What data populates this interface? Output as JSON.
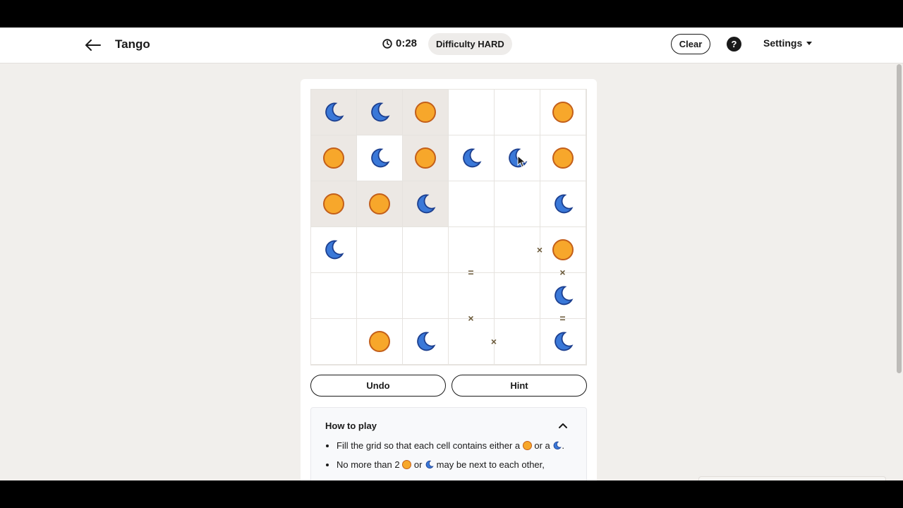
{
  "header": {
    "back_icon": "arrow-left-icon",
    "title": "Tango",
    "timer": "0:28",
    "timer_icon": "clock-icon",
    "difficulty": "Difficulty HARD",
    "clear_label": "Clear",
    "help_label": "?",
    "settings_label": "Settings"
  },
  "grid": {
    "rows": [
      [
        "moon",
        "moon",
        "sun",
        "",
        "",
        "sun"
      ],
      [
        "sun",
        "moon",
        "sun",
        "moon",
        "moon",
        "sun"
      ],
      [
        "sun",
        "sun",
        "moon",
        "",
        "",
        "moon"
      ],
      [
        "moon",
        "",
        "",
        "",
        "",
        "sun"
      ],
      [
        "",
        "",
        "",
        "",
        "",
        "moon"
      ],
      [
        "",
        "sun",
        "moon",
        "",
        "",
        "moon"
      ]
    ],
    "locked": [
      [
        true,
        true,
        true,
        false,
        false,
        false
      ],
      [
        true,
        false,
        true,
        false,
        false,
        false
      ],
      [
        true,
        true,
        true,
        false,
        false,
        false
      ],
      [
        false,
        false,
        false,
        false,
        false,
        false
      ],
      [
        false,
        false,
        false,
        false,
        false,
        false
      ],
      [
        false,
        false,
        false,
        false,
        false,
        false
      ]
    ],
    "constraints": [
      {
        "symbol": "×",
        "between": "r3c4-r3c5"
      },
      {
        "symbol": "=",
        "between": "r3c3-r4c3"
      },
      {
        "symbol": "×",
        "between": "r3c5-r4c5"
      },
      {
        "symbol": "×",
        "between": "r4c3-r5c3"
      },
      {
        "symbol": "=",
        "between": "r4c5-r5c5"
      },
      {
        "symbol": "×",
        "between": "r5c3-r5c4"
      }
    ]
  },
  "actions": {
    "undo_label": "Undo",
    "hint_label": "Hint"
  },
  "how_to_play": {
    "title": "How to play",
    "rule1_before": "Fill the grid so that each cell contains either a",
    "rule1_mid": "or a",
    "rule1_end": ".",
    "rule2_before": "No more than 2",
    "rule2_mid": "or",
    "rule2_end": "may be next to each other,"
  },
  "colors": {
    "sun_fill": "#f7a72b",
    "sun_stroke": "#c35f1a",
    "moon_fill": "#3a78d8",
    "moon_stroke": "#1c3f8f",
    "locked_cell": "#ece8e4"
  }
}
